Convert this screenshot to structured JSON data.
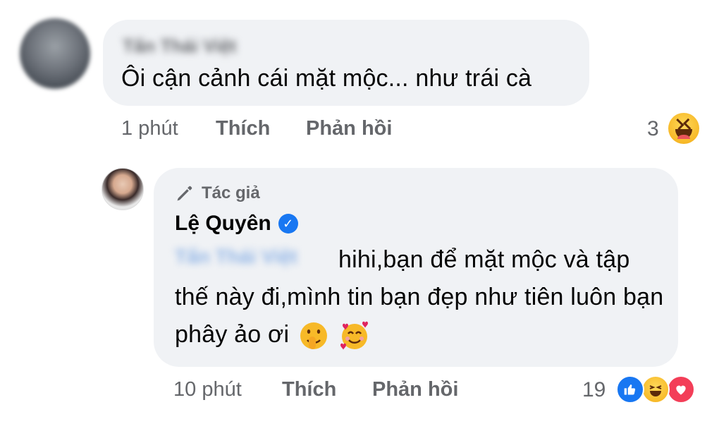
{
  "comment": {
    "author": "Tấn Thái Việt",
    "text": "Ôi cận cảnh cái mặt mộc... như trái cà",
    "time": "1 phút",
    "like_label": "Thích",
    "reply_label": "Phản hồi",
    "reaction_count": "3",
    "reaction_icon": "haha-emoji-icon"
  },
  "reply": {
    "badge_icon": "pencil-icon",
    "badge_label": "Tác giả",
    "author": "Lệ Quyên",
    "verified_icon": "verified-check-icon",
    "mention": "Tấn Thái Việt",
    "text": "hihi,bạn để mặt mộc và tập thế này đi,mình tin bạn đẹp như tiên luôn bạn phây ảo ơi",
    "emoji_1": "shushing-face-emoji",
    "emoji_2": "smiling-face-with-hearts-emoji",
    "time": "10 phút",
    "like_label": "Thích",
    "reply_label": "Phản hồi",
    "reaction_count": "19",
    "reaction_icons": [
      "like-icon",
      "haha-icon",
      "love-icon"
    ]
  },
  "colors": {
    "bubble": "#f0f2f5",
    "meta_text": "#65676b",
    "like_blue": "#1877f2",
    "love_red": "#f33e58",
    "haha_yellow": "#f7b928"
  }
}
